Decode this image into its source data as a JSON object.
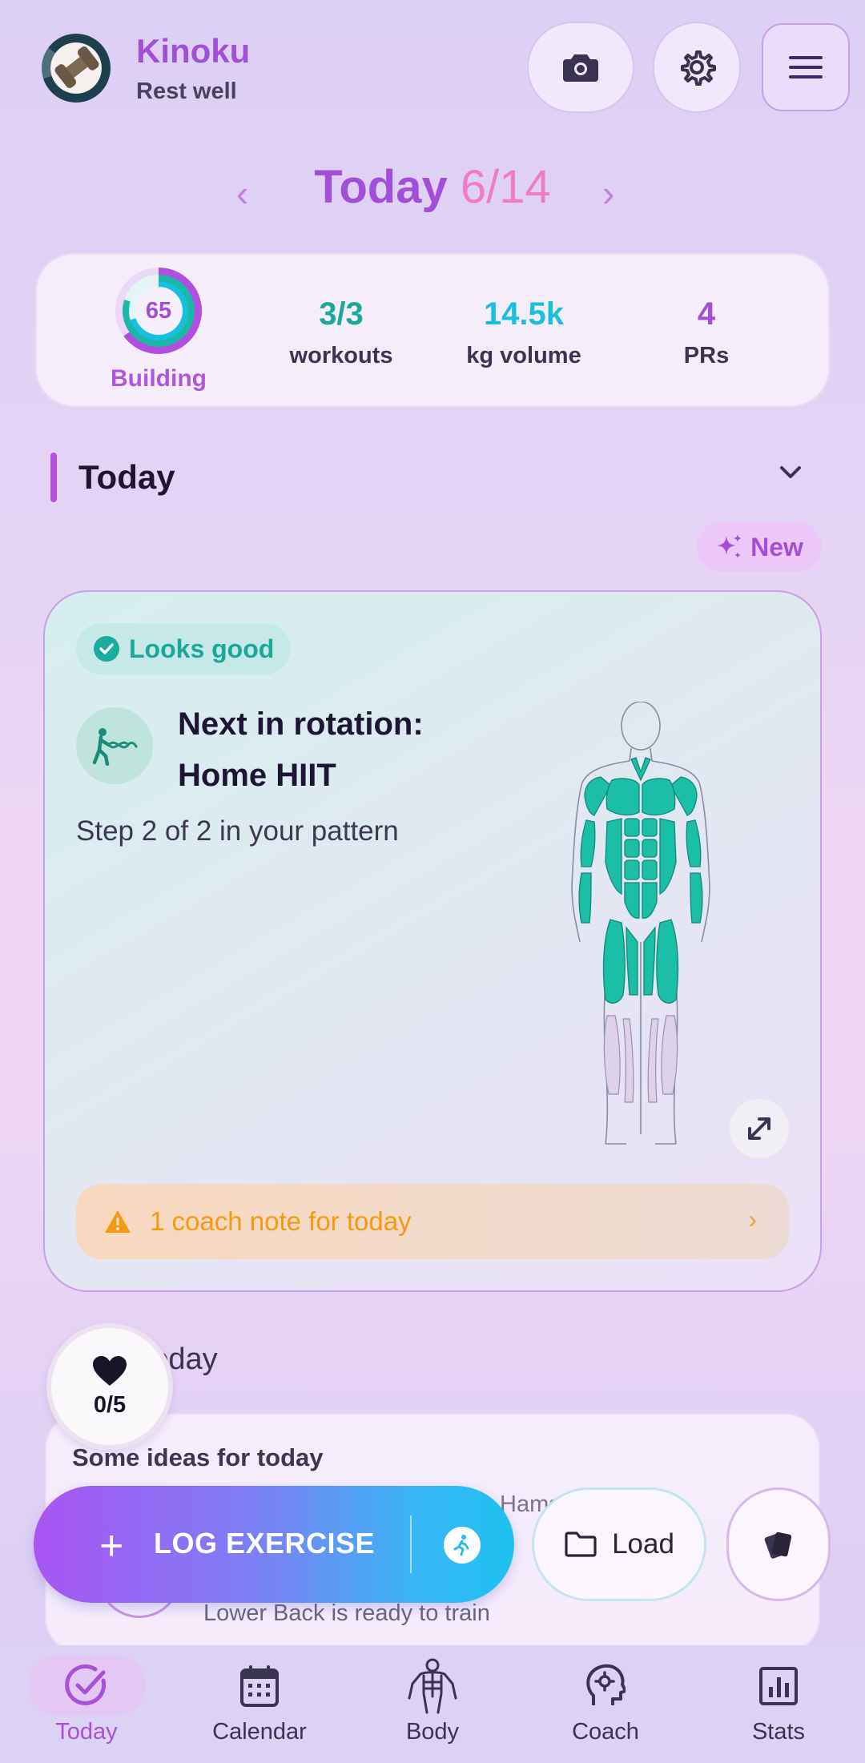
{
  "header": {
    "app_name": "Kinoku",
    "subtitle": "Rest well",
    "icons": [
      "camera-icon",
      "gear-icon",
      "hamburger-menu-icon"
    ]
  },
  "date_nav": {
    "prev": "‹",
    "next": "›",
    "label": "Today",
    "date": "6/14"
  },
  "summary": {
    "score": "65",
    "score_label": "Building",
    "workouts_value": "3/3",
    "workouts_label": "workouts",
    "volume_value": "14.5k",
    "volume_label": "kg volume",
    "prs_value": "4",
    "prs_label": "PRs"
  },
  "section": {
    "title": "Today",
    "new_label": "New"
  },
  "recommendation": {
    "status": "Looks good",
    "title_line1": "Next in rotation:",
    "title_line2": "Home HIIT",
    "step": "Step 2 of 2 in your pattern",
    "coach_note": "1 coach note for today"
  },
  "rest": {
    "label": "Rest today",
    "hearts": "0/5",
    "ideas_title": "Some ideas for today",
    "muscle_hint": "Hamstrings",
    "lower_back": "Lower Back is ready to train"
  },
  "actions": {
    "log_label": "LOG EXERCISE",
    "load_label": "Load"
  },
  "nav": {
    "items": [
      {
        "label": "Today",
        "icon": "check-circle-icon"
      },
      {
        "label": "Calendar",
        "icon": "calendar-icon"
      },
      {
        "label": "Body",
        "icon": "body-icon"
      },
      {
        "label": "Coach",
        "icon": "coach-head-icon"
      },
      {
        "label": "Stats",
        "icon": "bar-chart-icon"
      }
    ]
  },
  "colors": {
    "accent": "#a24fd8",
    "teal": "#1aa89a",
    "cyan": "#18c0e0",
    "warning": "#f39a12"
  }
}
